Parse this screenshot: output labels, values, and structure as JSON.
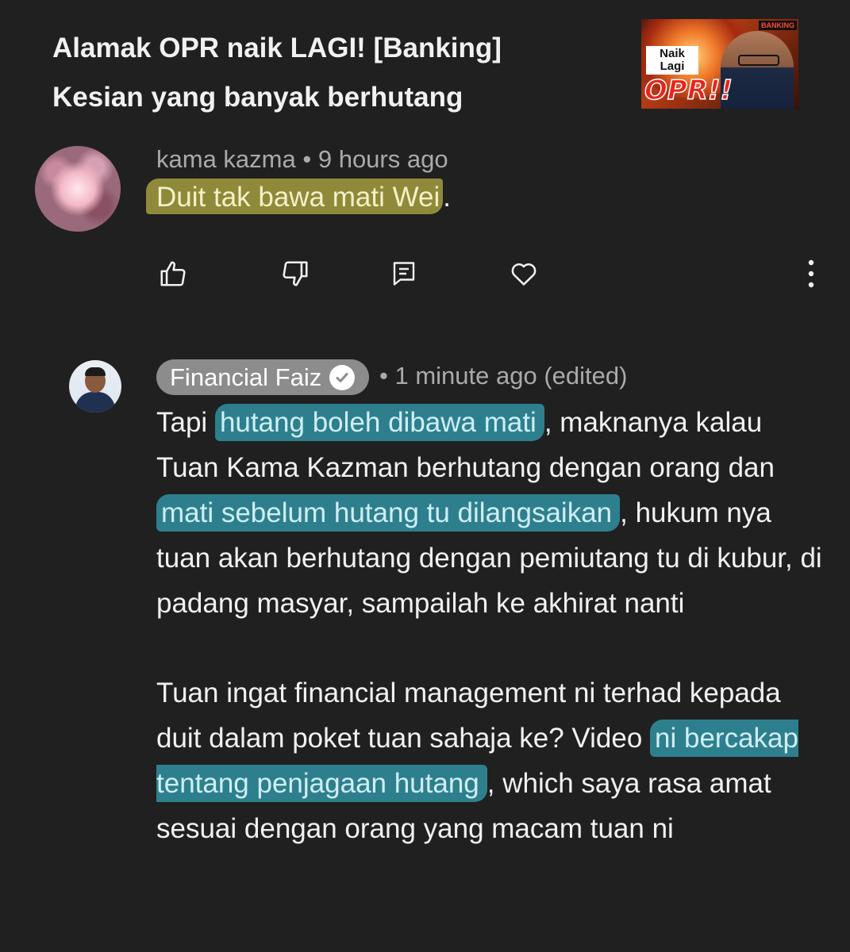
{
  "video": {
    "title_line1": "Alamak OPR naik LAGI! [Banking]",
    "title_line2": "Kesian yang banyak berhutang",
    "thumbnail": {
      "tag": "BANKING",
      "naik_text": "Naik Lagi",
      "opr_text": "OPR!!"
    }
  },
  "comment": {
    "author": "kama kazma",
    "separator": "•",
    "time": "9 hours ago",
    "text_highlighted": "Duit tak bawa mati Wei",
    "text_after": ".",
    "actions": {
      "like_icon": "thumbs-up-icon",
      "dislike_icon": "thumbs-down-icon",
      "reply_icon": "comment-icon",
      "heart_icon": "heart-icon",
      "more_icon": "more-vertical-icon"
    }
  },
  "reply": {
    "author": "Financial Faiz",
    "verified_icon": "verified-check-icon",
    "meta": "• 1 minute ago (edited)",
    "p1_a": "Tapi ",
    "p1_hl1": "hutang boleh dibawa mati",
    "p1_b": ", maknanya kalau Tuan Kama Kazman berhutang dengan orang dan ",
    "p1_hl2": "mati sebelum hutang tu dilangsaikan",
    "p1_c": ", hukum nya tuan akan berhutang dengan pemiutang tu di kubur, di padang masyar, sampailah ke akhirat nanti",
    "p2_a": "Tuan ingat financial management ni terhad kepada duit dalam poket tuan sahaja ke? Video ",
    "p2_hl": "ni bercakap tentang penjagaan hutang",
    "p2_b": ", which saya rasa amat sesuai dengan orang yang macam tuan ni"
  }
}
